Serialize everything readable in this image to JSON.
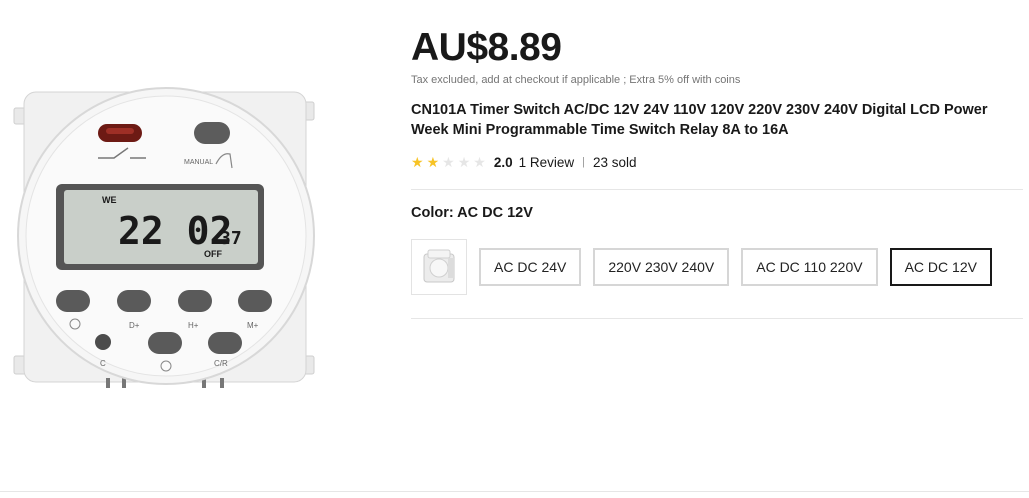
{
  "price": "AU$8.89",
  "tax_note": "Tax excluded, add at checkout if applicable ; Extra 5% off with coins",
  "title": "CN101A Timer Switch AC/DC 12V 24V 110V 120V 220V 230V 240V Digital LCD Power Week Mini Programmable Time Switch Relay 8A to 16A",
  "rating": {
    "score": "2.0",
    "stars_filled": 2,
    "stars_total": 5,
    "reviews": "1 Review",
    "separator": "|",
    "sold": "23 sold"
  },
  "color": {
    "label": "Color: AC DC 12V",
    "options": [
      "AC DC 24V",
      "220V 230V 240V",
      "AC DC 110 220V",
      "AC DC 12V"
    ],
    "selected": "AC DC 12V"
  },
  "device": {
    "manual_label": "MANUAL",
    "lcd_day": "WE",
    "lcd_time": "22 02",
    "lcd_seconds": "37",
    "lcd_state": "OFF",
    "button_labels": [
      "D+",
      "H+",
      "M+",
      "C",
      "C/R"
    ]
  },
  "colors": {
    "star_filled": "#f7c325",
    "star_empty": "#e6e6e6",
    "selected_border": "#191919"
  }
}
